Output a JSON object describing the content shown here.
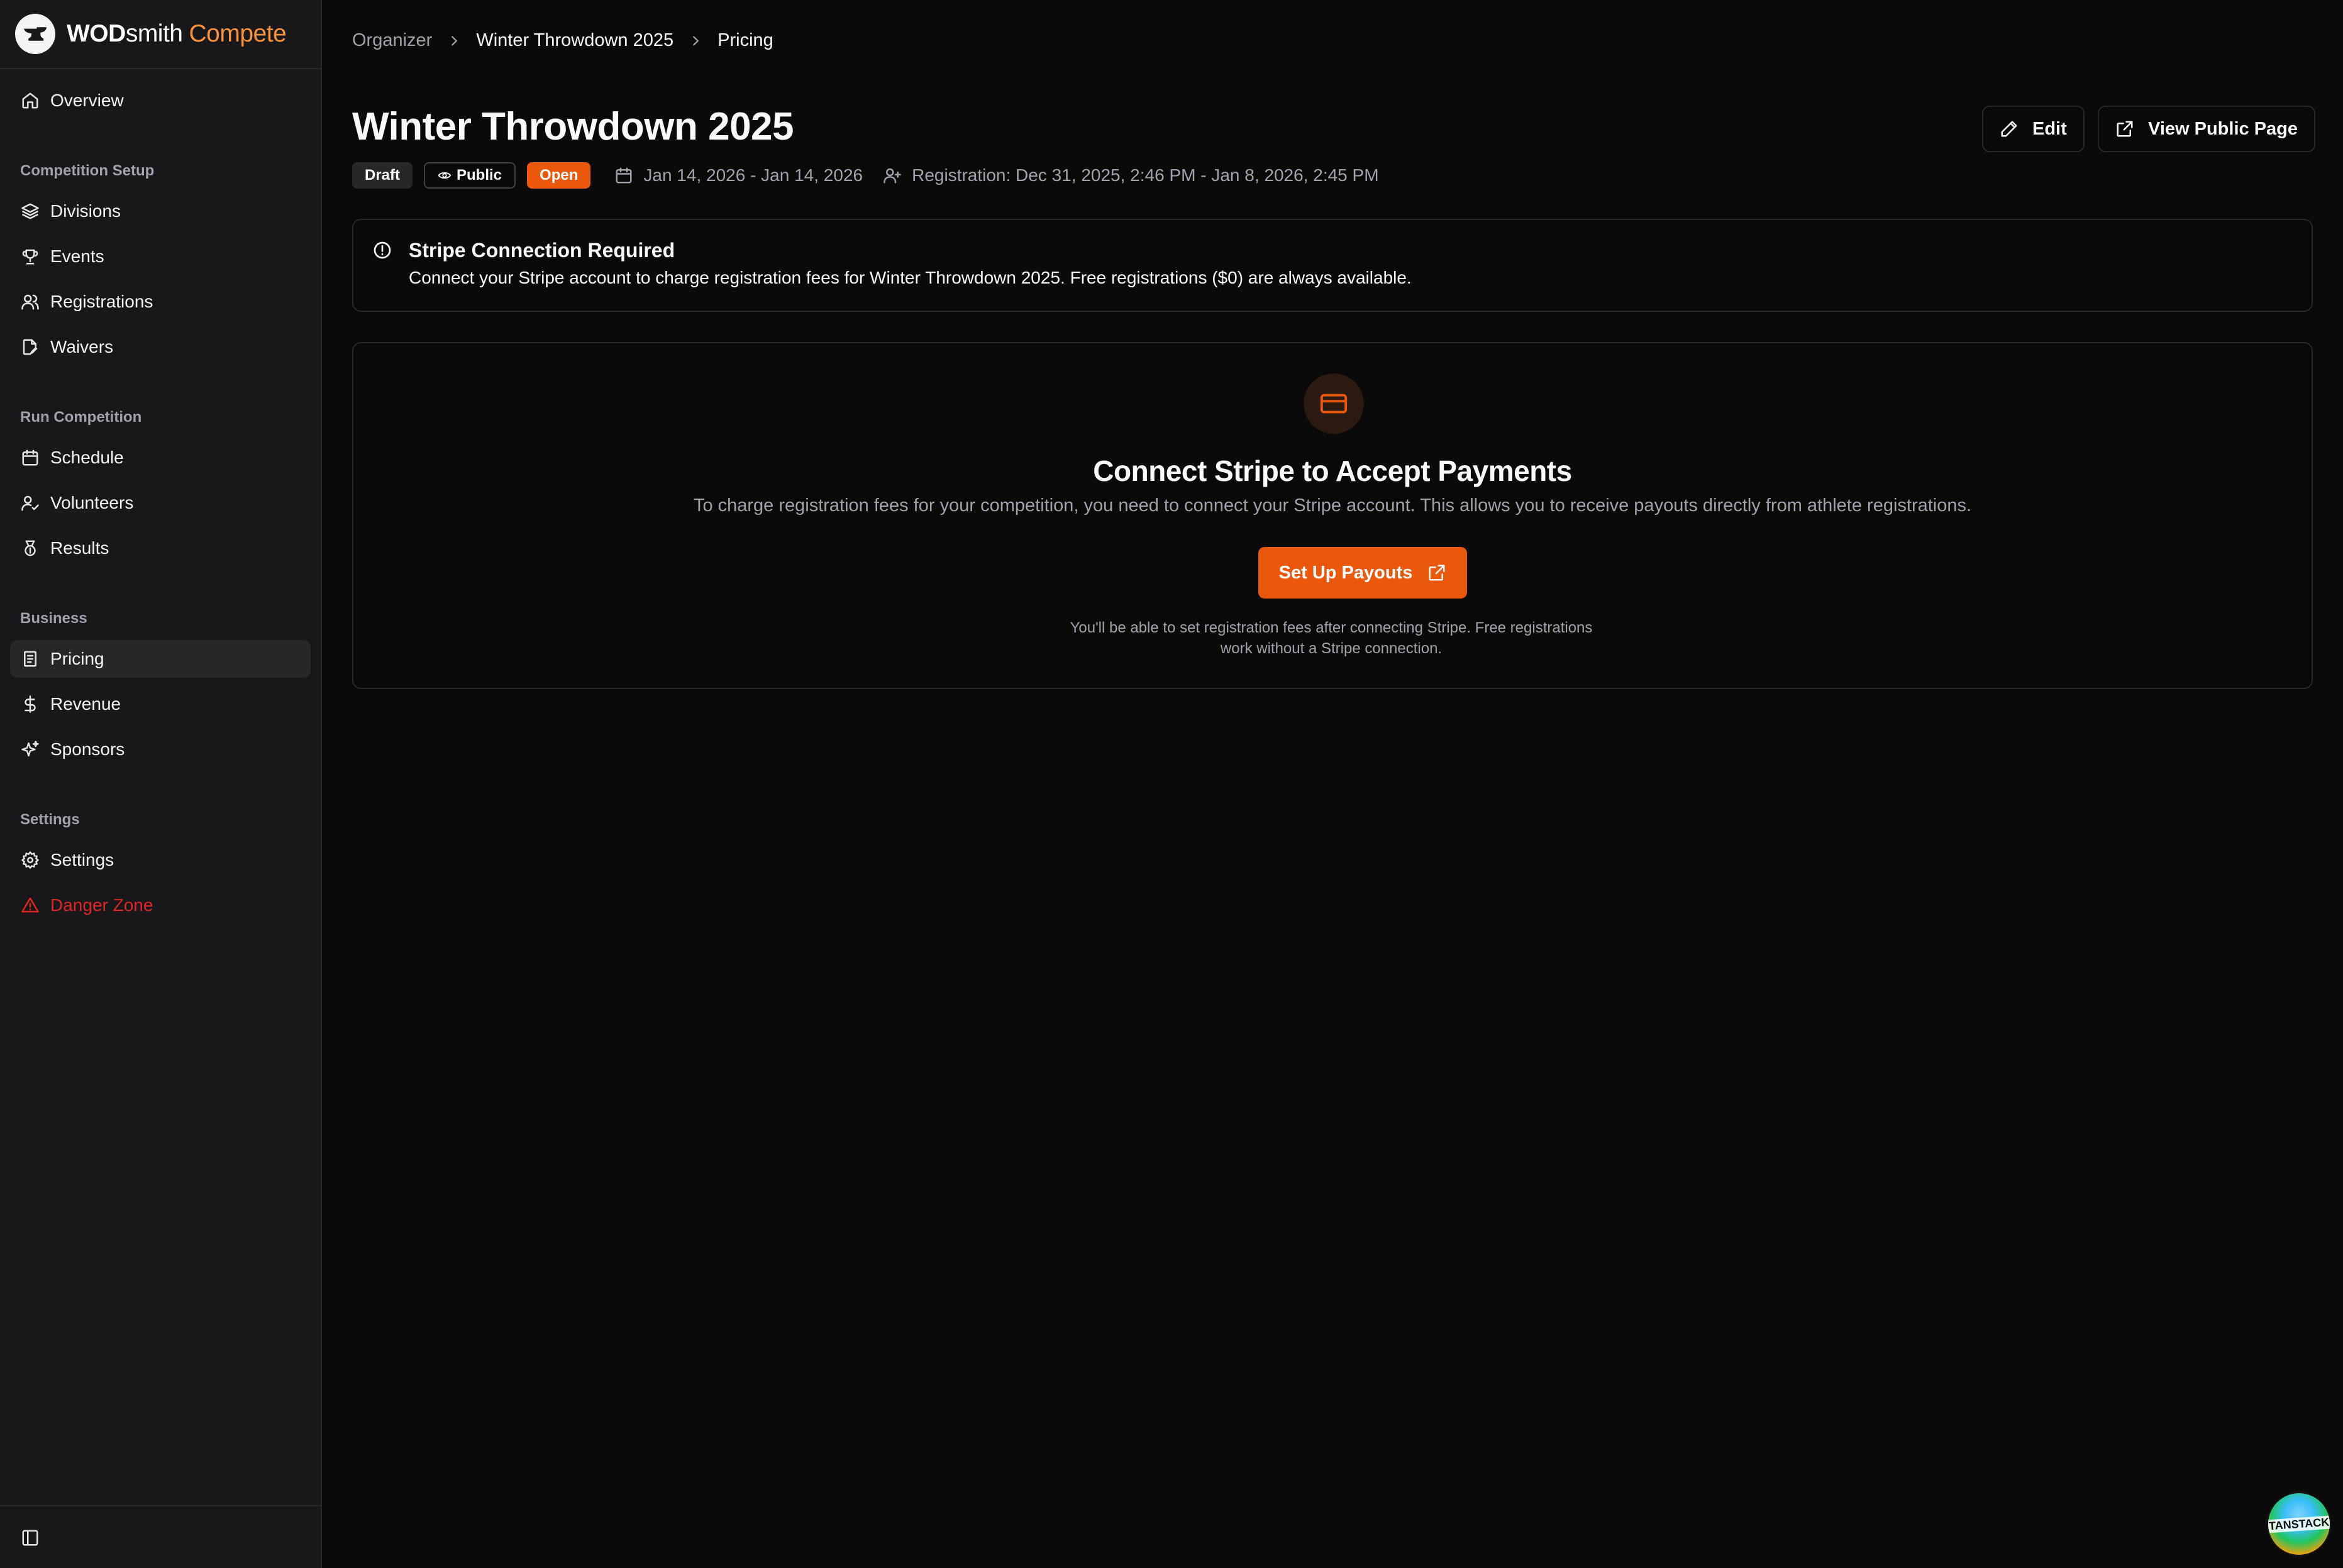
{
  "brand": {
    "wod": "WOD",
    "smith": "smith",
    "compete": "Compete"
  },
  "sidebar": {
    "overview": "Overview",
    "sections": [
      {
        "title": "Competition Setup",
        "items": [
          "Divisions",
          "Events",
          "Registrations",
          "Waivers"
        ]
      },
      {
        "title": "Run Competition",
        "items": [
          "Schedule",
          "Volunteers",
          "Results"
        ]
      },
      {
        "title": "Business",
        "items": [
          "Pricing",
          "Revenue",
          "Sponsors"
        ]
      },
      {
        "title": "Settings",
        "items": [
          "Settings",
          "Danger Zone"
        ]
      }
    ],
    "active": "Pricing"
  },
  "breadcrumb": [
    "Organizer",
    "Winter Throwdown 2025",
    "Pricing"
  ],
  "page": {
    "title": "Winter Throwdown 2025",
    "badges": {
      "draft": "Draft",
      "public": "Public",
      "open": "Open"
    },
    "dates": "Jan 14, 2026 - Jan 14, 2026",
    "registration": "Registration: Dec 31, 2025, 2:46 PM - Jan 8, 2026, 2:45 PM",
    "edit_label": "Edit",
    "view_public_label": "View Public Page"
  },
  "alert": {
    "title": "Stripe Connection Required",
    "description": "Connect your Stripe account to charge registration fees for Winter Throwdown 2025. Free registrations ($0) are always available."
  },
  "card": {
    "title": "Connect Stripe to Accept Payments",
    "description": "To charge registration fees for your competition, you need to connect your Stripe account. This allows you to receive payouts directly from athlete registrations.",
    "button_label": "Set Up Payouts",
    "note_line1": "You'll be able to set registration fees after connecting Stripe. Free registrations",
    "note_line2": "work without a Stripe connection."
  },
  "devtools_label": "TANSTACK",
  "colors": {
    "accent": "#ea580c",
    "brand_orange": "#fb923c",
    "danger": "#dc2626"
  }
}
